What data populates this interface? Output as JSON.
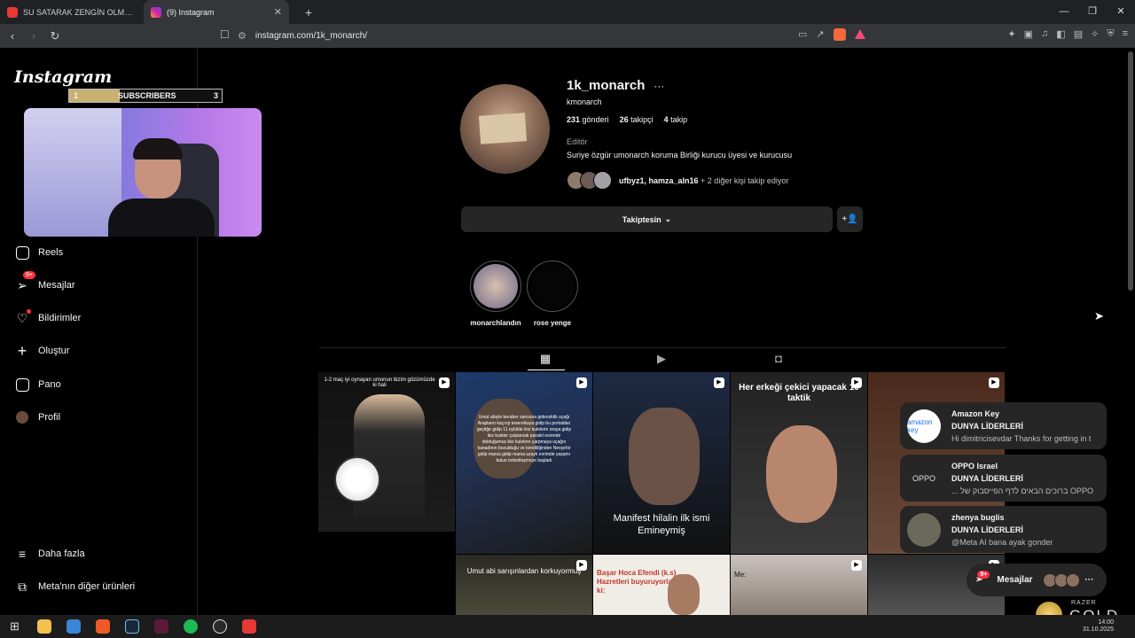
{
  "browser": {
    "tabs": [
      {
        "label": "SU SATARAK ZENGİN OLMAK! | KATL",
        "active": false
      },
      {
        "label": "(9) Instagram",
        "active": true
      }
    ],
    "new_tab": "+",
    "url": "instagram.com/1k_monarch/",
    "win_controls": [
      "—",
      "❐",
      "✕"
    ]
  },
  "sidebar": {
    "logo": "Instagram",
    "items": [
      {
        "label": "Reels",
        "icon": "reels-icon"
      },
      {
        "label": "Mesajlar",
        "icon": "messages-icon",
        "badge": "9+"
      },
      {
        "label": "Bildirimler",
        "icon": "heart-icon"
      },
      {
        "label": "Oluştur",
        "icon": "plus-icon"
      },
      {
        "label": "Pano",
        "icon": "dashboard-icon"
      },
      {
        "label": "Profil",
        "icon": "profile-avatar"
      }
    ],
    "bottom": [
      {
        "label": "Daha fazla",
        "icon": "menu-icon"
      },
      {
        "label": "Meta'nın diğer ürünleri",
        "icon": "meta-apps-icon"
      }
    ]
  },
  "overlay": {
    "subs_current": "1",
    "subs_label": "SUBSCRIBERS",
    "subs_goal": "3",
    "subs_progress": 0.33
  },
  "profile": {
    "username": "1k_monarch",
    "more": "···",
    "full_name": "kmonarch",
    "posts_count": "231",
    "posts_label": "gönderi",
    "followers_count": "26",
    "followers_label": "takipçi",
    "following_count": "4",
    "following_label": "takip",
    "category": "Editör",
    "bio": "Suriye özgür umonarch koruma Birliği kurucu üyesi ve kurucusu",
    "followed_by_names": "ufbyz1, hamza_aln16",
    "followed_by_rest": " + 2 diğer kişi takip ediyor",
    "follow_button": "Takiptesin",
    "highlights": [
      {
        "label": "monarchlandın"
      },
      {
        "label": "rose yenge"
      }
    ]
  },
  "posts": [
    {
      "caption": "1-2 maç iyi oynayan umonun bizim gözümüzde ki hali"
    },
    {
      "caption": "Umut abiyle beraber sansuna gidecektik uçağı Arapların kaçırıp teservikaya gidip bu portaldan geçtiğe gidip 11 eylülde ikiz kulelerin oraya gidip ikiz kuleler çarparsak paralel evrende dolduğumuz ikiz kulelere çarpmaya uçağın kanadının bozulduğu ve kendiliğinden Nevşehir gidip marsa gidip marsa uzaylı evrimde yaşamı buluo kolonileşmeye başladı"
    },
    {
      "caption": "Manifest hilalin ilk ismi Emineymiş"
    },
    {
      "caption": "Her erkeği çekici yapacak 10 taktik"
    },
    {
      "caption": ""
    },
    {
      "caption": "Umut abi sarışınlardan korkuyormuş"
    },
    {
      "caption": "Başar Hoca Efendi (k.s) Hazretleri buyuruyorlar ki:"
    },
    {
      "caption": "Me:"
    }
  ],
  "notifications": [
    {
      "name": "Amazon Key",
      "line2": "DUNYA LİDERLERİ",
      "line3": "Hi dimitricisevdar Thanks for getting in t",
      "img_text": "amazon key"
    },
    {
      "name": "OPPO Israel",
      "line2": "DUNYA LİDERLERİ",
      "line3": "... ברוכים הבאים לדף הפייסבוק של OPPO",
      "img_text": "OPPO"
    },
    {
      "name": "zhenya buglis",
      "line2": "DUNYA LİDERLERİ",
      "line3": "@Meta AI bana ayak gonder",
      "img_text": ""
    }
  ],
  "messages_pill": {
    "label": "Mesajlar",
    "badge": "9+",
    "more": "···"
  },
  "taskbar": {
    "time": "14:00",
    "date": "31.10.2025"
  },
  "razer": {
    "brand": "RAZER",
    "tier": "GOLD"
  }
}
